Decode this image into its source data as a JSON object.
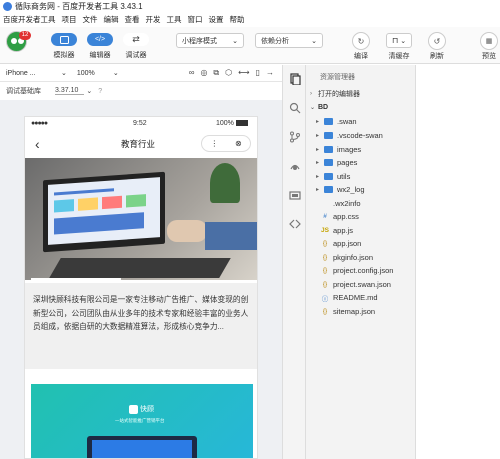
{
  "window": {
    "title": "循际商务网 - 百度开发者工具 3.43.1"
  },
  "menu": [
    "百度开发者工具",
    "项目",
    "文件",
    "编辑",
    "查看",
    "开发",
    "工具",
    "窗口",
    "设置",
    "帮助"
  ],
  "user": {
    "badge": "12"
  },
  "toolbar": {
    "simulator": "模拟器",
    "editor": "编辑器",
    "debugger": "调试器",
    "mode_select": "小程序模式",
    "analysis_select": "依赖分析",
    "compile": "编译",
    "clear_cache": "清缓存",
    "refresh": "刷新",
    "preview": "预览"
  },
  "device": {
    "model": "iPhone ...",
    "zoom": "100%"
  },
  "library": {
    "label": "调试基础库",
    "version": "3.37.10"
  },
  "phone": {
    "time": "9:52",
    "battery": "100%",
    "page_title": "教育行业",
    "description": "深圳快顾科技有限公司是一家专注移动广告推广、媒体变现的创新型公司，公司团队由从业多年的技术专家和经验丰富的业务人员组成，依据自研的大数据精准算法，形成核心竞争力...",
    "banner_brand": "快顾",
    "banner_sub": "一站式智能推广营销平台"
  },
  "explorer": {
    "header": "资源管理器",
    "open_editors": "打开的编辑器",
    "root": "BD",
    "items": [
      {
        "name": ".swan",
        "type": "folder"
      },
      {
        "name": ".vscode-swan",
        "type": "folder"
      },
      {
        "name": "images",
        "type": "folder"
      },
      {
        "name": "pages",
        "type": "folder"
      },
      {
        "name": "utils",
        "type": "folder"
      },
      {
        "name": "wx2_log",
        "type": "folder"
      },
      {
        "name": ".wx2info",
        "type": "file",
        "icon": ""
      },
      {
        "name": "app.css",
        "type": "file",
        "icon": "#"
      },
      {
        "name": "app.js",
        "type": "file",
        "icon": "JS"
      },
      {
        "name": "app.json",
        "type": "file",
        "icon": "{}"
      },
      {
        "name": "pkginfo.json",
        "type": "file",
        "icon": "{}"
      },
      {
        "name": "project.config.json",
        "type": "file",
        "icon": "{}"
      },
      {
        "name": "project.swan.json",
        "type": "file",
        "icon": "{}"
      },
      {
        "name": "README.md",
        "type": "file",
        "icon": "ⓘ"
      },
      {
        "name": "sitemap.json",
        "type": "file",
        "icon": "{}"
      }
    ]
  },
  "colors": {
    "accent": "#3b84d8",
    "folder": "#3b84d8",
    "js": "#c5a300",
    "json": "#b8860b",
    "css": "#1565c0"
  }
}
